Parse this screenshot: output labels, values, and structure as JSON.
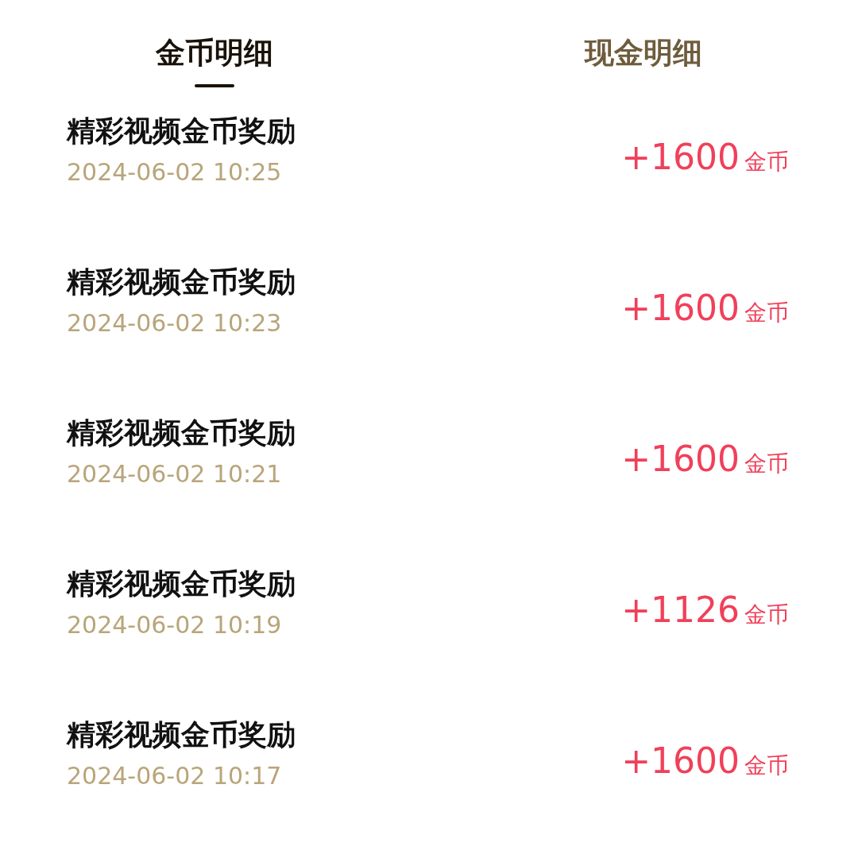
{
  "tabs": [
    {
      "label": "金币明细",
      "selected": true
    },
    {
      "label": "现金明细",
      "selected": false
    }
  ],
  "records": [
    {
      "title": "精彩视频金币奖励",
      "time": "2024-06-02 10:25",
      "amount": "+1600",
      "unit": "金币"
    },
    {
      "title": "精彩视频金币奖励",
      "time": "2024-06-02 10:23",
      "amount": "+1600",
      "unit": "金币"
    },
    {
      "title": "精彩视频金币奖励",
      "time": "2024-06-02 10:21",
      "amount": "+1600",
      "unit": "金币"
    },
    {
      "title": "精彩视频金币奖励",
      "time": "2024-06-02 10:19",
      "amount": "+1126",
      "unit": "金币"
    },
    {
      "title": "精彩视频金币奖励",
      "time": "2024-06-02 10:17",
      "amount": "+1600",
      "unit": "金币"
    }
  ]
}
